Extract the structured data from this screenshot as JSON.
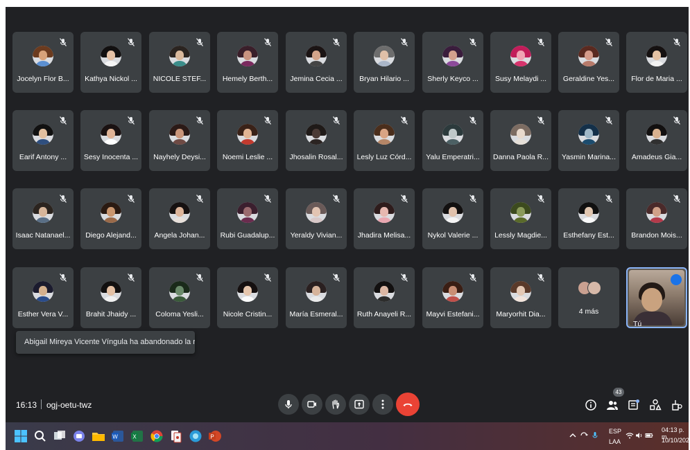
{
  "participants": [
    {
      "name": "Jocelyn Flor B...",
      "skin": "#d7a27a",
      "hair": "#6b3b1f",
      "shirt": "#5b8fd1"
    },
    {
      "name": "Kathya Nickol ...",
      "skin": "#e5c1a5",
      "hair": "#121010",
      "shirt": "#f5f5f5"
    },
    {
      "name": "NICOLE STEF...",
      "skin": "#d9b89b",
      "hair": "#2b2420",
      "shirt": "#3b8d8a"
    },
    {
      "name": "Hemely Berth...",
      "skin": "#c99380",
      "hair": "#3a1f2a",
      "shirt": "#7a2a5e"
    },
    {
      "name": "Jemina Cecia ...",
      "skin": "#d2a48a",
      "hair": "#1b1414",
      "shirt": "#444444"
    },
    {
      "name": "Bryan Hilario ...",
      "skin": "#e0c0a8",
      "hair": "#6d6d6d",
      "shirt": "#aab6c8"
    },
    {
      "name": "Sherly Keyco ...",
      "skin": "#d3a08e",
      "hair": "#3a1d3c",
      "shirt": "#8c4a9a"
    },
    {
      "name": "Susy Melaydi ...",
      "skin": "#f0a4b4",
      "hair": "#c21d5a",
      "shirt": "#d6336c"
    },
    {
      "name": "Geraldine Yes...",
      "skin": "#d59b8a",
      "hair": "#5a2a20",
      "shirt": "#b77a6a"
    },
    {
      "name": "Flor de Maria ...",
      "skin": "#e4c2a3",
      "hair": "#151111",
      "shirt": "#f2f2f2"
    },
    {
      "name": "Earif Antony ...",
      "skin": "#e1bf9f",
      "hair": "#111111",
      "shirt": "#2f4f7f"
    },
    {
      "name": "Sesy Inocenta ...",
      "skin": "#dfb396",
      "hair": "#1a1212",
      "shirt": "#ffffff"
    },
    {
      "name": "Nayhely Deysi...",
      "skin": "#c9957a",
      "hair": "#2b1a17",
      "shirt": "#6e4a44"
    },
    {
      "name": "Noemi Leslie ...",
      "skin": "#e1b493",
      "hair": "#3a2218",
      "shirt": "#c23a2e"
    },
    {
      "name": "Jhosalin Rosal...",
      "skin": "#4b3b36",
      "hair": "#1f1a18",
      "shirt": "#2b2422"
    },
    {
      "name": "Lesly Luz Córd...",
      "skin": "#d8a484",
      "hair": "#4a2e1c",
      "shirt": "#b58667"
    },
    {
      "name": "Yalu Emperatri...",
      "skin": "#bfc8c9",
      "hair": "#2c3a3c",
      "shirt": "#4c6064"
    },
    {
      "name": "Danna Paola R...",
      "skin": "#e8d9cc",
      "hair": "#7c6c62",
      "shirt": "#e6e0d8"
    },
    {
      "name": "Yasmin Marina...",
      "skin": "#9fb7c7",
      "hair": "#143049",
      "shirt": "#1c4c6e"
    },
    {
      "name": "Amadeus Gia...",
      "skin": "#d8b18f",
      "hair": "#121010",
      "shirt": "#303030"
    },
    {
      "name": "Isaac Natanael...",
      "skin": "#d6b59a",
      "hair": "#2b241f",
      "shirt": "#5a6f86"
    },
    {
      "name": "Diego Alejand...",
      "skin": "#c9966f",
      "hair": "#2a1a12",
      "shirt": "#9a6a4a"
    },
    {
      "name": "Angela Johan...",
      "skin": "#dcb49a",
      "hair": "#161111",
      "shirt": "#e8e0da"
    },
    {
      "name": "Rubi Guadalup...",
      "skin": "#9a6a6e",
      "hair": "#3b1f2e",
      "shirt": "#6a2c4e"
    },
    {
      "name": "Yeraldy Vivian...",
      "skin": "#e2c4b2",
      "hair": "#6a5a58",
      "shirt": "#d8c8c8"
    },
    {
      "name": "Jhadira Melisa...",
      "skin": "#e6b8b0",
      "hair": "#2e1c1c",
      "shirt": "#e9a7b0"
    },
    {
      "name": "Nykol Valerie ...",
      "skin": "#dfc1ac",
      "hair": "#121010",
      "shirt": "#f4f4f4"
    },
    {
      "name": "Lessly Magdie...",
      "skin": "#8a9a5a",
      "hair": "#3c4a1e",
      "shirt": "#5a6a2a"
    },
    {
      "name": "Esthefany Est...",
      "skin": "#e0c6b0",
      "hair": "#101010",
      "shirt": "#f8f8f8"
    },
    {
      "name": "Brandon Mois...",
      "skin": "#d0a088",
      "hair": "#4a2a2a",
      "shirt": "#b33a4a"
    },
    {
      "name": "Esther Vera V...",
      "skin": "#d4b08e",
      "hair": "#1b1b2e",
      "shirt": "#2a4c8a"
    },
    {
      "name": "Brahit Jhaidy ...",
      "skin": "#e3c0a4",
      "hair": "#121010",
      "shirt": "#f0f0f0"
    },
    {
      "name": "Coloma Yesli...",
      "skin": "#6a8a6a",
      "hair": "#1a2a1a",
      "shirt": "#3a5a3a"
    },
    {
      "name": "Nicole Cristin...",
      "skin": "#e5c5ac",
      "hair": "#151010",
      "shirt": "#fafafa"
    },
    {
      "name": "María Esmeral...",
      "skin": "#d6b39a",
      "hair": "#2a2020",
      "shirt": "#eaeaea"
    },
    {
      "name": "Ruth Anayeli R...",
      "skin": "#dbb7a4",
      "hair": "#121010",
      "shirt": "#2c2c2c"
    },
    {
      "name": "Mayvi Estefani...",
      "skin": "#c98e74",
      "hair": "#3a1e14",
      "shirt": "#c0504a"
    },
    {
      "name": "Maryorhit Dia...",
      "skin": "#e4c8b4",
      "hair": "#5a3a2a",
      "shirt": "#f2e4dc"
    }
  ],
  "more_tile": {
    "label": "4 más"
  },
  "self_tile": {
    "label": "Tú"
  },
  "toast": {
    "text": "Abigail Mireya Vicente Víngula ha abandonado la reunión"
  },
  "meeting": {
    "time": "16:13",
    "code": "ogj-oetu-twz",
    "people_count": "43"
  },
  "controls": [
    "mic-icon",
    "camera-icon",
    "raise-hand-icon",
    "present-icon",
    "more-options-icon"
  ],
  "taskbar": {
    "lang_line1": "ESP",
    "lang_line2": "LAA",
    "time": "04:13 p. m.",
    "date": "10/10/2022"
  },
  "colors": {
    "meet_bg": "#202124",
    "tile_bg": "#3c4043",
    "leave": "#ea4335",
    "active": "#8ab4f8"
  }
}
